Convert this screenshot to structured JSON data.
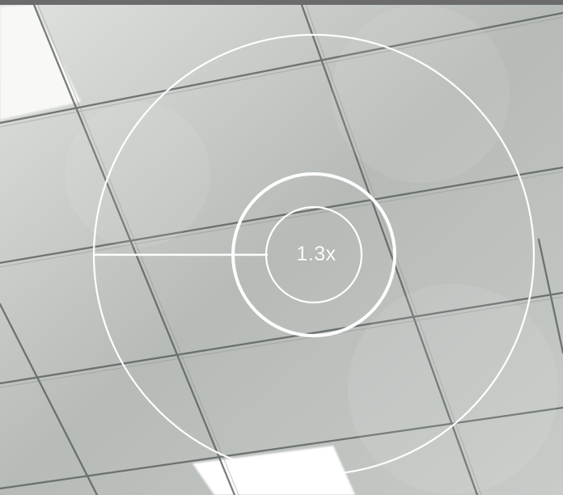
{
  "camera": {
    "zoom_label": "1.3x"
  },
  "zoom_control": {
    "handle_icon": "zoom-handle-icon",
    "ring_color": "#ffffff"
  }
}
